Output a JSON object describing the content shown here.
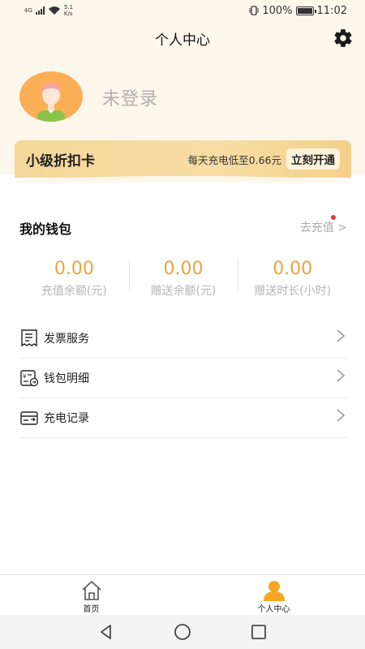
{
  "status_bar": {
    "network": "4G",
    "speed_value": "5.1",
    "speed_unit": "K/s",
    "battery": "100%",
    "time": "11:02"
  },
  "header": {
    "title": "个人中心"
  },
  "profile": {
    "login_text": "未登录"
  },
  "discount_card": {
    "title": "小级折扣卡",
    "description": "每天充电低至0.66元",
    "button": "立刻开通"
  },
  "wallet": {
    "title": "我的钱包",
    "recharge_link": "去充值 >",
    "stats": [
      {
        "value": "0.00",
        "label": "充值余额(元)"
      },
      {
        "value": "0.00",
        "label": "赠送余额(元)"
      },
      {
        "value": "0.00",
        "label": "赠送时长(小时)"
      }
    ]
  },
  "menu": [
    {
      "label": "发票服务",
      "icon": "invoice-icon"
    },
    {
      "label": "钱包明细",
      "icon": "wallet-detail-icon"
    },
    {
      "label": "充电记录",
      "icon": "charge-record-icon"
    }
  ],
  "bottom_nav": [
    {
      "label": "首页",
      "icon": "home-icon",
      "active": false
    },
    {
      "label": "个人中心",
      "icon": "user-icon",
      "active": true
    }
  ],
  "colors": {
    "accent": "#f2a23b",
    "card_gold": "#f5d08a",
    "background_top": "#fdf6ea"
  }
}
